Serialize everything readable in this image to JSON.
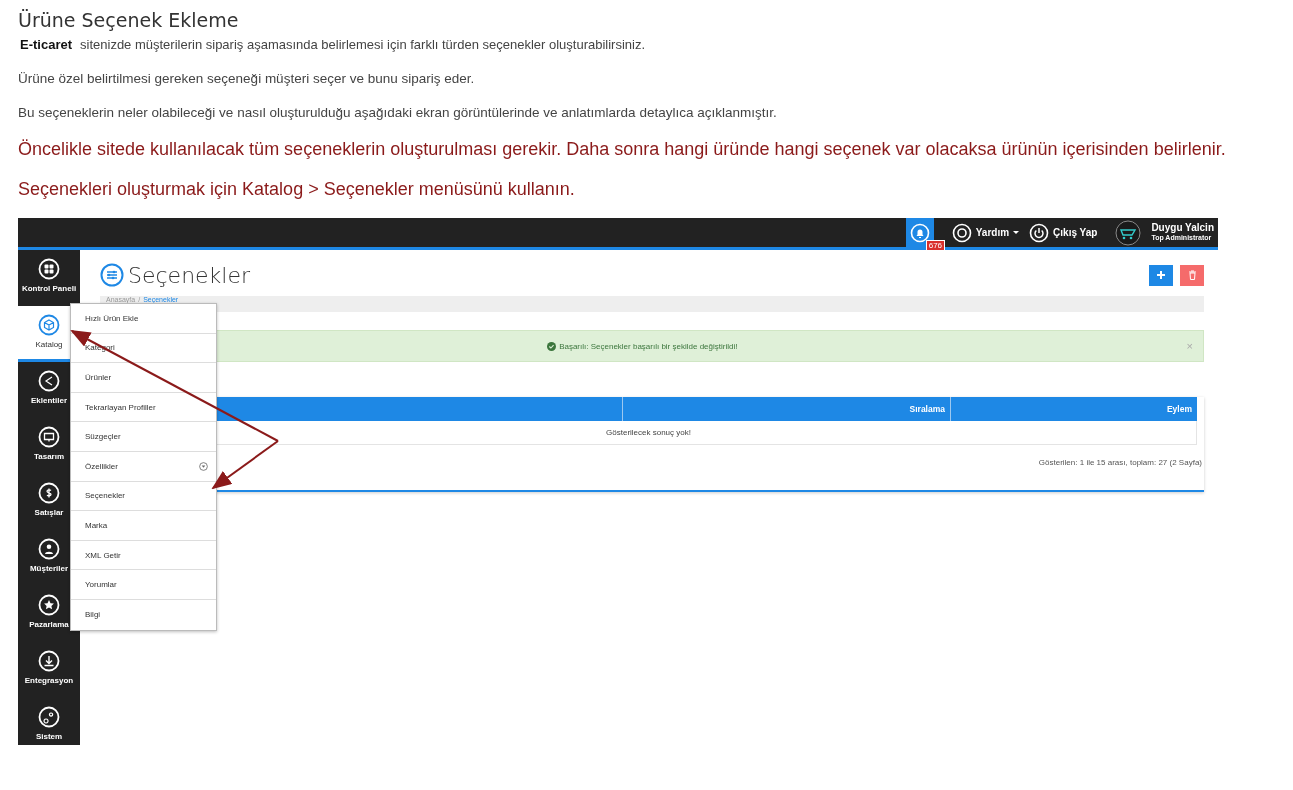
{
  "article": {
    "title": "Ürüne Seçenek Ekleme",
    "brand": "E-ticaret",
    "intro": "sitenizde müşterilerin sipariş aşamasında belirlemesi için farklı türden seçenekler oluşturabilirsiniz.",
    "paragraphs": [
      "Ürüne özel belirtilmesi gereken seçeneği müşteri seçer ve bunu sipariş eder.",
      "Bu seçeneklerin neler olabileceği ve nasıl oluşturulduğu aşağıdaki ekran görüntülerinde ve anlatımlarda detaylıca açıklanmıştır."
    ],
    "notes": [
      "Öncelikle sitede kullanılacak tüm seçeneklerin oluşturulması gerekir. Daha sonra hangi üründe hangi seçenek var olacaksa ürünün içerisinden belirlenir.",
      "Seçenekleri oluşturmak için Katalog > Seçenekler menüsünü kullanın."
    ]
  },
  "screenshot": {
    "top_bar": {
      "notification_count": "676",
      "help": "Yardım",
      "logout": "Çıkış Yap",
      "user_name": "Duygu Yalcin",
      "user_role": "Top Administrator"
    },
    "sidebar": {
      "items": [
        {
          "label": "Kontrol Paneli",
          "selected": false
        },
        {
          "label": "Katalog",
          "selected": true
        },
        {
          "label": "Eklentiler",
          "selected": false
        },
        {
          "label": "Tasarım",
          "selected": false
        },
        {
          "label": "Satışlar",
          "selected": false
        },
        {
          "label": "Müşteriler",
          "selected": false
        },
        {
          "label": "Pazarlama",
          "selected": false
        },
        {
          "label": "Entegrasyon",
          "selected": false
        },
        {
          "label": "Sistem",
          "selected": false
        }
      ]
    },
    "catalog_menu": {
      "items": [
        {
          "label": "Hızlı Ürün Ekle",
          "expandable": false
        },
        {
          "label": "Kategori",
          "expandable": false
        },
        {
          "label": "Ürünler",
          "expandable": false
        },
        {
          "label": "Tekrarlayan Profiller",
          "expandable": false
        },
        {
          "label": "Süzgeçler",
          "expandable": false
        },
        {
          "label": "Özellikler",
          "expandable": true
        },
        {
          "label": "Seçenekler",
          "expandable": false
        },
        {
          "label": "Marka",
          "expandable": false
        },
        {
          "label": "XML Getir",
          "expandable": false
        },
        {
          "label": "Yorumlar",
          "expandable": false
        },
        {
          "label": "Bilgi",
          "expandable": false
        }
      ]
    },
    "page_title": "Seçenekler",
    "breadcrumb": [
      "Anasayfa",
      "Seçenekler"
    ],
    "breadcrumb_separator": "/",
    "alert": {
      "text": "Başarılı: Seçenekler başarılı bir şekilde değiştirildi!",
      "close": "×"
    },
    "table": {
      "columns": [
        "Sıralama",
        "Eylem"
      ],
      "empty_message": "Gösterilecek sonuç yok!"
    },
    "pagination": "Gösterilen: 1 ile 15 arası, toplam: 27 (2 Sayfa)"
  }
}
